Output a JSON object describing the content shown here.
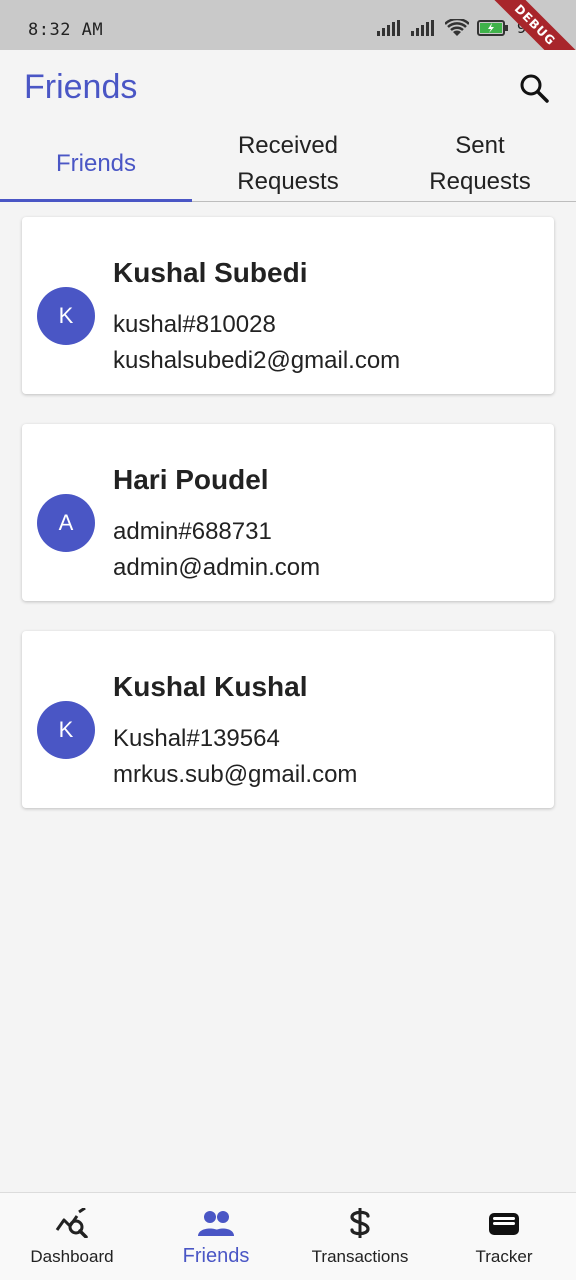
{
  "status_bar": {
    "time": "8:32 AM",
    "battery": "96",
    "debug_label": "DEBUG"
  },
  "app_bar": {
    "title": "Friends",
    "search_icon": "search-icon"
  },
  "tabs": [
    {
      "label": "Friends",
      "active": true
    },
    {
      "label": "Received\nRequests",
      "active": false
    },
    {
      "label": "Sent\nRequests",
      "active": false
    }
  ],
  "friends": [
    {
      "initial": "K",
      "name": "Kushal Subedi",
      "handle": "kushal#810028",
      "email": "kushalsubedi2@gmail.com"
    },
    {
      "initial": "A",
      "name": "Hari Poudel",
      "handle": "admin#688731",
      "email": "admin@admin.com"
    },
    {
      "initial": "K",
      "name": "Kushal Kushal",
      "handle": "Kushal#139564",
      "email": "mrkus.sub@gmail.com"
    }
  ],
  "bottom_nav": [
    {
      "label": "Dashboard",
      "icon": "chart-search-icon",
      "active": false
    },
    {
      "label": "Friends",
      "icon": "people-icon",
      "active": true
    },
    {
      "label": "Transactions",
      "icon": "dollar-icon",
      "active": false
    },
    {
      "label": "Tracker",
      "icon": "wallet-icon",
      "active": false
    }
  ],
  "colors": {
    "accent": "#4a56c5",
    "background": "#f4f4f4",
    "status_bar": "#c9c9c9",
    "debug_ribbon": "#a8262b"
  }
}
